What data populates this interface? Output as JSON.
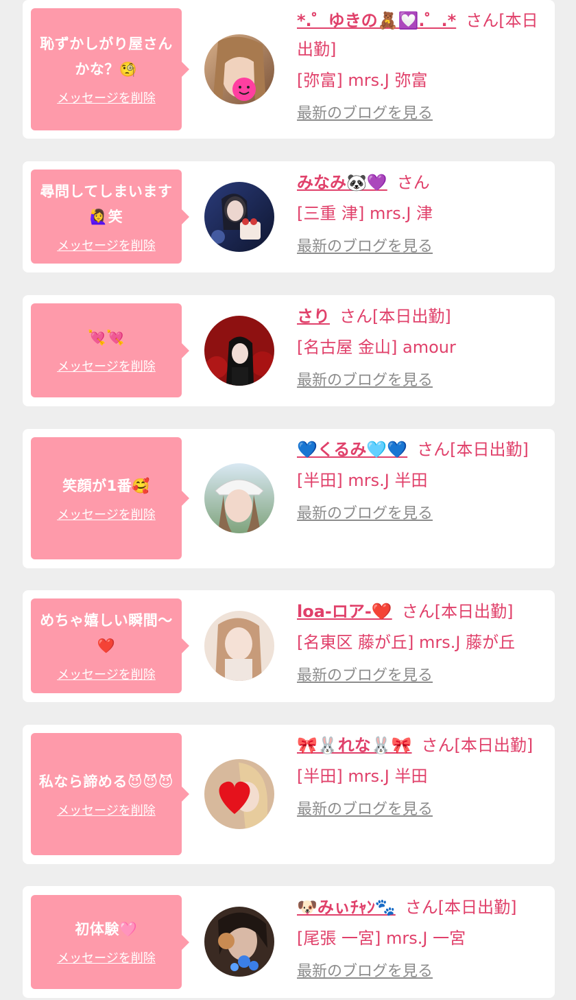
{
  "theme": {
    "bubble_color": "#fe9aaa",
    "accent_color": "#e0406a",
    "link_gray": "#8c8c8c",
    "page_bg": "#eeeeee"
  },
  "cards": [
    {
      "message": "恥ずかしがり屋さんかな？🧐",
      "delete_label": "メッセージを削除",
      "name": "*.゜ゆきの🧸💟.゜.*",
      "suffix": "さん[本日出勤]",
      "shop": "[弥富] mrs.J 弥富",
      "blog_label": "最新のブログを見る"
    },
    {
      "message": "尋問してしまいます🙋‍♀️笑",
      "delete_label": "メッセージを削除",
      "name": "みなみ🐼💜",
      "suffix": "さん",
      "shop": "[三重 津] mrs.J 津",
      "blog_label": "最新のブログを見る"
    },
    {
      "message": "💘💘",
      "delete_label": "メッセージを削除",
      "name": "さり",
      "suffix": "さん[本日出勤]",
      "shop": "[名古屋 金山] amour",
      "blog_label": "最新のブログを見る"
    },
    {
      "message": "笑顔が1番🥰",
      "delete_label": "メッセージを削除",
      "name": "💙くるみ🩵💙",
      "suffix": "さん[本日出勤]",
      "shop": "[半田] mrs.J 半田",
      "blog_label": "最新のブログを見る"
    },
    {
      "message": "めちゃ嬉しい瞬間〜❤️",
      "delete_label": "メッセージを削除",
      "name": "loa-ロア-❤️",
      "suffix": "さん[本日出勤]",
      "shop": "[名東区 藤が丘] mrs.J 藤が丘",
      "blog_label": "最新のブログを見る"
    },
    {
      "message": "私なら諦める😈😈😈",
      "delete_label": "メッセージを削除",
      "name": "🎀🐰れな🐰🎀",
      "suffix": "さん[本日出勤]",
      "shop": "[半田] mrs.J 半田",
      "blog_label": "最新のブログを見る"
    },
    {
      "message": "初体験🩷",
      "delete_label": "メッセージを削除",
      "name": "🐶みぃﾁｬﾝ🐾",
      "suffix": "さん[本日出勤]",
      "shop": "[尾張 一宮] mrs.J 一宮",
      "blog_label": "最新のブログを見る"
    }
  ]
}
